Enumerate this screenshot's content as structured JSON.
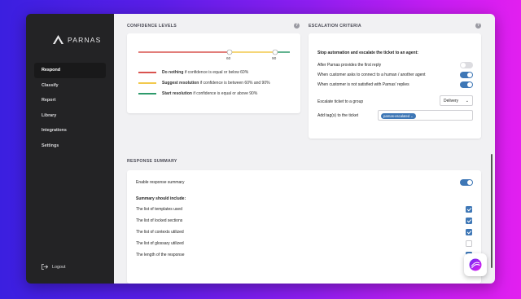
{
  "app": {
    "brand": "PARNAS"
  },
  "sidebar": {
    "items": [
      {
        "label": "Respond",
        "active": true
      },
      {
        "label": "Classify",
        "active": false
      },
      {
        "label": "Report",
        "active": false
      },
      {
        "label": "Library",
        "active": false
      },
      {
        "label": "Integrations",
        "active": false
      },
      {
        "label": "Settings",
        "active": false
      }
    ],
    "logout_label": "Logout"
  },
  "confidence": {
    "title": "CONFIDENCE LEVELS",
    "slider": {
      "low_threshold": 60,
      "high_threshold": 90,
      "low_label": "60",
      "high_label": "90"
    },
    "legend": [
      {
        "bold": "Do nothing",
        "rest": " if confidence is equal or below 60%",
        "color": "#d9534f"
      },
      {
        "bold": "Suggest resolution",
        "rest": " if confidence is between 60% and 90%",
        "color": "#f2c94c"
      },
      {
        "bold": "Start resolution",
        "rest": " if confidence is equal or above 90%",
        "color": "#2e9a6b"
      }
    ]
  },
  "escalation": {
    "title": "ESCALATION CRITERIA",
    "heading": "Stop automation and escalate the ticket to an agent:",
    "options": [
      {
        "label": "After Parnas provides the first reply",
        "enabled": false
      },
      {
        "label": "When customer asks to connect to a human / another agent",
        "enabled": true
      },
      {
        "label": "When customer is not satisfied with Parnas' replies",
        "enabled": true
      }
    ],
    "group_label": "Escalate ticket to a group",
    "group_value": "Delivery",
    "tags_label": "Add tag(s) to the ticket",
    "tag_value": "parnas-escalated"
  },
  "summary": {
    "title": "RESPONSE SUMMARY",
    "enable_label": "Enable response summary",
    "enabled": true,
    "include_heading": "Summary should include:",
    "items": [
      {
        "label": "The list of templates used",
        "checked": true
      },
      {
        "label": "The list of locked sections",
        "checked": true
      },
      {
        "label": "The list of contexts utilized",
        "checked": true
      },
      {
        "label": "The list of glossary utilized",
        "checked": false
      },
      {
        "label": "The length of the response",
        "checked": true
      }
    ]
  },
  "colors": {
    "accent": "#3e77b6",
    "sidebar_bg": "#232325",
    "main_bg": "#f1f1f3"
  },
  "icons": {
    "help": "question-circle-icon",
    "logout": "logout-icon",
    "chat": "chat-widget-icon"
  }
}
